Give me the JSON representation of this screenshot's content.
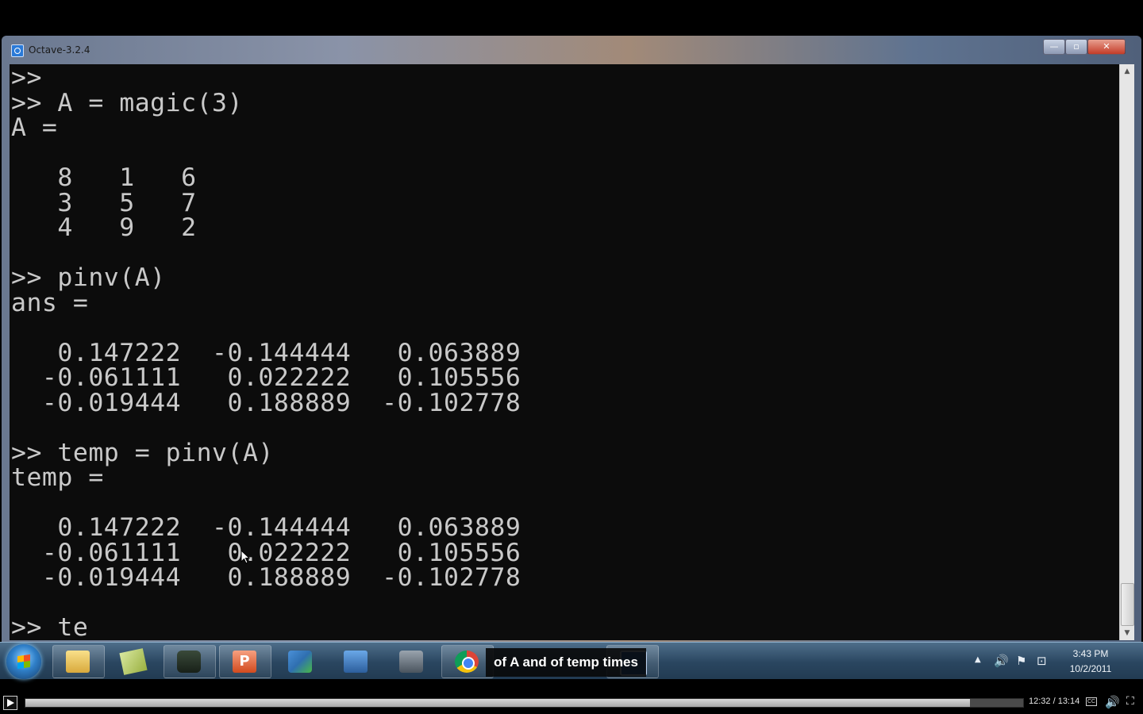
{
  "window": {
    "title": "Octave-3.2.4",
    "minimize_glyph": "—",
    "maximize_glyph": "▫",
    "close_glyph": "✕",
    "app_icon": "octave-icon"
  },
  "console": {
    "lines": [
      ">>",
      ">> A = magic(3)",
      "A =",
      "",
      "   8   1   6",
      "   3   5   7",
      "   4   9   2",
      "",
      ">> pinv(A)",
      "ans =",
      "",
      "   0.147222  -0.144444   0.063889",
      "  -0.061111   0.022222   0.105556",
      "  -0.019444   0.188889  -0.102778",
      "",
      ">> temp = pinv(A)",
      "temp =",
      "",
      "   0.147222  -0.144444   0.063889",
      "  -0.061111   0.022222   0.105556",
      "  -0.019444   0.188889  -0.102778",
      "",
      ">> te"
    ],
    "text_color": "#c9c9c9",
    "background": "#0c0c0c"
  },
  "scrollbar": {
    "up_glyph": "▲",
    "down_glyph": "▼"
  },
  "taskbar": {
    "start_icon": "windows-start-icon",
    "pinned": [
      {
        "name": "explorer-icon"
      },
      {
        "name": "app2-icon"
      },
      {
        "name": "app3-icon"
      },
      {
        "name": "powerpoint-icon",
        "glyph": "P"
      },
      {
        "name": "app5-icon"
      },
      {
        "name": "app6-icon"
      },
      {
        "name": "app7-icon"
      },
      {
        "name": "chrome-icon"
      },
      {
        "name": "octave-icon"
      }
    ],
    "tray": {
      "arrow": "▲",
      "speaker": "🔊",
      "flag": "⚑",
      "network": "⊡"
    },
    "clock": {
      "time": "3:43 PM",
      "date": "10/2/2011"
    }
  },
  "caption": {
    "text": "of A and of temp times"
  },
  "player": {
    "current_time": "12:32",
    "duration": "13:14",
    "time_display": "12:32 / 13:14",
    "progress": 0.9469,
    "cc_label": "CC",
    "volume_glyph": "🔊",
    "fullscreen_glyph": "⛶"
  }
}
